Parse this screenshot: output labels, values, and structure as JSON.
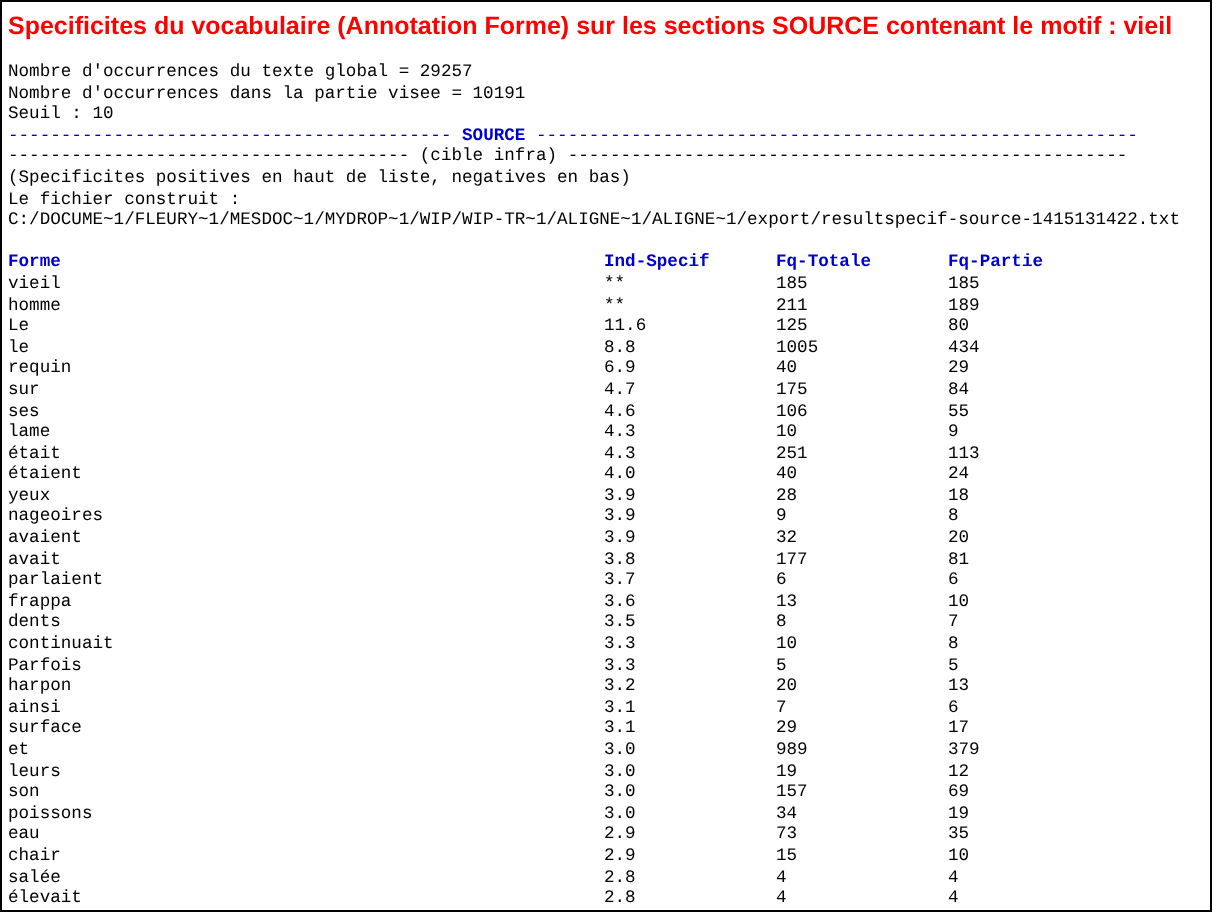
{
  "title": "Specificites du vocabulaire (Annotation Forme) sur les sections SOURCE contenant le motif : vieil",
  "info_lines": [
    "Nombre d'occurrences du texte global = 29257",
    "Nombre d'occurrences dans la partie visee = 10191",
    "Seuil : 10"
  ],
  "separators": [
    {
      "kind": "highlight",
      "left": "------------------------------------------",
      "label": "SOURCE",
      "right": "---------------------------------------------------------"
    },
    {
      "kind": "plain",
      "left": "--------------------------------------",
      "label": "(cible infra)",
      "right": "-----------------------------------------------------"
    }
  ],
  "notes": [
    "(Specificites positives en haut de liste, negatives en bas)",
    "Le fichier construit :",
    "C:/DOCUME~1/FLEURY~1/MESDOC~1/MYDROP~1/WIP/WIP-TR~1/ALIGNE~1/ALIGNE~1/export/resultspecif-source-1415131422.txt"
  ],
  "table": {
    "columns": [
      "Forme",
      "Ind-Specif",
      "Fq-Totale",
      "Fq-Partie"
    ],
    "rows": [
      [
        "vieil",
        "**",
        "185",
        "185"
      ],
      [
        "homme",
        "**",
        "211",
        "189"
      ],
      [
        "Le",
        "11.6",
        "125",
        "80"
      ],
      [
        "le",
        "8.8",
        "1005",
        "434"
      ],
      [
        "requin",
        "6.9",
        "40",
        "29"
      ],
      [
        "sur",
        "4.7",
        "175",
        "84"
      ],
      [
        "ses",
        "4.6",
        "106",
        "55"
      ],
      [
        "lame",
        "4.3",
        "10",
        "9"
      ],
      [
        "était",
        "4.3",
        "251",
        "113"
      ],
      [
        "étaient",
        "4.0",
        "40",
        "24"
      ],
      [
        "yeux",
        "3.9",
        "28",
        "18"
      ],
      [
        "nageoires",
        "3.9",
        "9",
        "8"
      ],
      [
        "avaient",
        "3.9",
        "32",
        "20"
      ],
      [
        "avait",
        "3.8",
        "177",
        "81"
      ],
      [
        "parlaient",
        "3.7",
        "6",
        "6"
      ],
      [
        "frappa",
        "3.6",
        "13",
        "10"
      ],
      [
        "dents",
        "3.5",
        "8",
        "7"
      ],
      [
        "continuait",
        "3.3",
        "10",
        "8"
      ],
      [
        "Parfois",
        "3.3",
        "5",
        "5"
      ],
      [
        "harpon",
        "3.2",
        "20",
        "13"
      ],
      [
        "ainsi",
        "3.1",
        "7",
        "6"
      ],
      [
        "surface",
        "3.1",
        "29",
        "17"
      ],
      [
        "et",
        "3.0",
        "989",
        "379"
      ],
      [
        "leurs",
        "3.0",
        "19",
        "12"
      ],
      [
        "son",
        "3.0",
        "157",
        "69"
      ],
      [
        "poissons",
        "3.0",
        "34",
        "19"
      ],
      [
        "eau",
        "2.9",
        "73",
        "35"
      ],
      [
        "chair",
        "2.9",
        "15",
        "10"
      ],
      [
        "salée",
        "2.8",
        "4",
        "4"
      ],
      [
        "élevait",
        "2.8",
        "4",
        "4"
      ]
    ]
  }
}
